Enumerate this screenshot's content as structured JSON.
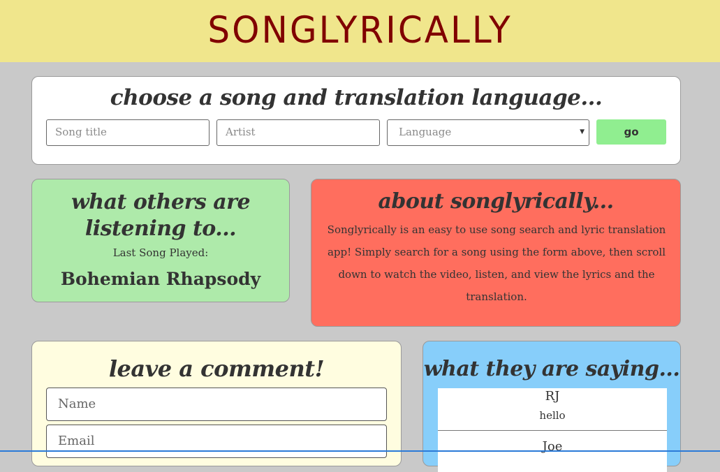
{
  "header": {
    "logo": "SONGLYRICALLY"
  },
  "search": {
    "title": "choose a song and translation language...",
    "song_placeholder": "Song title",
    "artist_placeholder": "Artist",
    "language_value": "Language",
    "go_label": "go"
  },
  "listening": {
    "title": "what others are listening to...",
    "last_label": "Last Song Played:",
    "last_song": "Bohemian Rhapsody"
  },
  "about": {
    "title": "about songlyrically...",
    "text": "Songlyrically is an easy to use song search and lyric translation app! Simply search for a song using the form above, then scroll down to watch the video, listen, and view the lyrics and the translation."
  },
  "comment_form": {
    "title": "leave a comment!",
    "name_placeholder": "Name",
    "email_placeholder": "Email"
  },
  "saying": {
    "title": "what they are saying...",
    "comments": [
      {
        "name": "RJ",
        "message": "hello"
      },
      {
        "name": "Joe",
        "message": ""
      }
    ]
  },
  "colors": {
    "header_bg": "#f0e68c",
    "logo": "#800000",
    "go_button": "#90ee90",
    "listening_bg": "#aeeaaa",
    "about_bg": "#ff6e5e",
    "comment_bg": "#fffde0",
    "saying_bg": "#87cefa"
  }
}
